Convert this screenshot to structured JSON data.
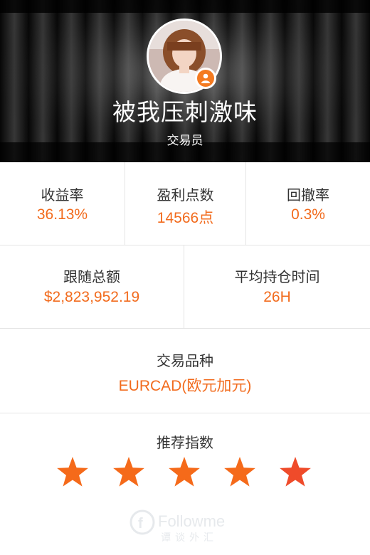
{
  "profile": {
    "name": "被我压刺激味",
    "role": "交易员"
  },
  "stats_row1": [
    {
      "label": "收益率",
      "value": "36.13%"
    },
    {
      "label": "盈利点数",
      "value": "14566点"
    },
    {
      "label": "回撤率",
      "value": "0.3%"
    }
  ],
  "stats_row2": [
    {
      "label": "跟随总额",
      "value": "$2,823,952.19"
    },
    {
      "label": "平均持仓时间",
      "value": "26H"
    }
  ],
  "instrument": {
    "label": "交易品种",
    "value": "EURCAD(欧元加元)"
  },
  "rating": {
    "label": "推荐指数",
    "stars": 5,
    "star_color": "#f56a1a",
    "last_star_color": "#ef4b2a"
  },
  "colors": {
    "accent": "#f26b1d",
    "header_bg": "#0b0b0b"
  },
  "watermark": {
    "brand": "Followme",
    "sub": "谭谈外汇"
  },
  "icons": {
    "badge": "person-icon",
    "star": "star-icon"
  }
}
